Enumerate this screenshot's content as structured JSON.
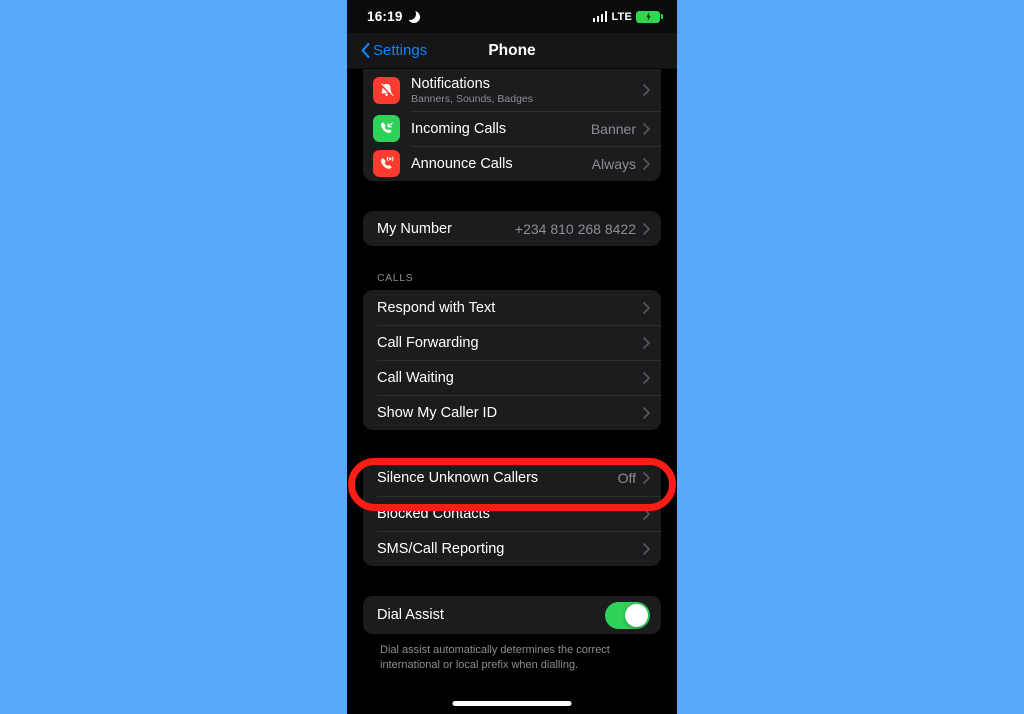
{
  "background_color": "#56a9fb",
  "status_bar": {
    "time": "16:19",
    "dnd_icon": "crescent-moon-icon",
    "signal_icon": "cellular-bars-icon",
    "network": "LTE",
    "battery_icon": "battery-charging-icon",
    "battery_color": "#32d74b"
  },
  "nav": {
    "back_label": "Settings",
    "back_icon": "chevron-left-icon",
    "title": "Phone",
    "accent_color": "#0a84ff"
  },
  "groups": {
    "notifications_group": {
      "rows": [
        {
          "label": "Notifications",
          "sublabel": "Banners, Sounds, Badges",
          "value": "",
          "icon": "bell-slash-icon",
          "icon_color": "#ff3b30",
          "accessory": "chevron-right-icon"
        },
        {
          "label": "Incoming Calls",
          "sublabel": "",
          "value": "Banner",
          "icon": "incoming-call-icon",
          "icon_color": "#30d158",
          "accessory": "chevron-right-icon"
        },
        {
          "label": "Announce Calls",
          "sublabel": "",
          "value": "Always",
          "icon": "announce-call-icon",
          "icon_color": "#ff3b30",
          "accessory": "chevron-right-icon"
        }
      ]
    },
    "my_number_group": {
      "rows": [
        {
          "label": "My Number",
          "value": "+234 810 268 8422",
          "accessory": "chevron-right-icon"
        }
      ]
    },
    "calls_section": {
      "header": "CALLS",
      "rows": [
        {
          "label": "Respond with Text",
          "value": "",
          "accessory": "chevron-right-icon"
        },
        {
          "label": "Call Forwarding",
          "value": "",
          "accessory": "chevron-right-icon"
        },
        {
          "label": "Call Waiting",
          "value": "",
          "accessory": "chevron-right-icon"
        },
        {
          "label": "Show My Caller ID",
          "value": "",
          "accessory": "chevron-right-icon"
        }
      ]
    },
    "blocking_group": {
      "rows": [
        {
          "label": "Silence Unknown Callers",
          "value": "Off",
          "accessory": "chevron-right-icon"
        },
        {
          "label": "Blocked Contacts",
          "value": "",
          "accessory": "chevron-right-icon"
        },
        {
          "label": "SMS/Call Reporting",
          "value": "",
          "accessory": "chevron-right-icon"
        }
      ]
    },
    "dial_assist_group": {
      "rows": [
        {
          "label": "Dial Assist",
          "toggle": "on",
          "toggle_color": "#30d158"
        }
      ],
      "footer": "Dial assist automatically determines the correct international or local prefix when dialling."
    }
  },
  "annotation": {
    "highlight_target": "Silence Unknown Callers",
    "color": "#fc1e16",
    "shape": "rounded-rectangle-outline"
  },
  "home_indicator": "home-indicator-bar"
}
